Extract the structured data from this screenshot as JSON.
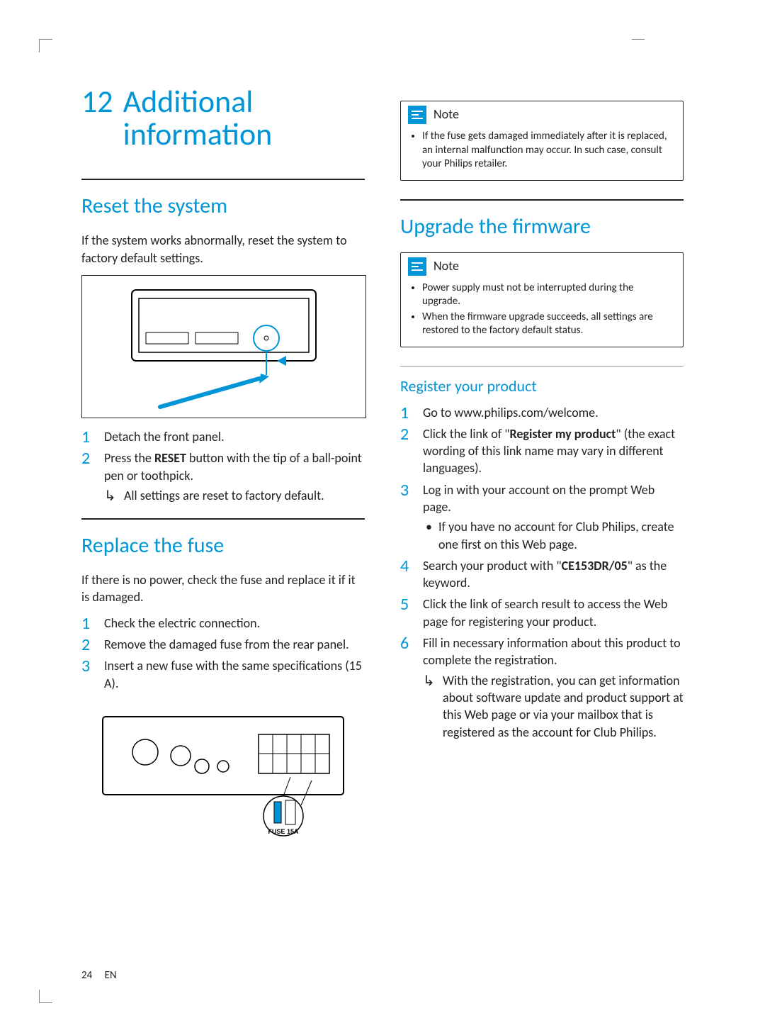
{
  "chapter": {
    "number": "12",
    "title": "Additional information"
  },
  "left": {
    "reset": {
      "heading": "Reset the system",
      "intro": "If the system works abnormally, reset the system to factory default settings.",
      "steps": [
        {
          "text": "Detach the front panel."
        },
        {
          "text_pre": "Press the ",
          "bold": "RESET",
          "text_post": " button with the tip of a ball-point pen or toothpick.",
          "result": "All settings are reset to factory default."
        }
      ]
    },
    "fuse": {
      "heading": "Replace the fuse",
      "intro": "If there is no power, check the fuse and replace it if it is damaged.",
      "steps": [
        "Check the electric connection.",
        "Remove the damaged fuse from the rear panel.",
        "Insert a new fuse with the same specifications (15 A)."
      ],
      "fuse_label": "FUSE 15A"
    }
  },
  "right": {
    "note1": {
      "label": "Note",
      "items": [
        "If the fuse gets damaged immediately after it is replaced, an internal malfunction may occur. In such case, consult your Philips retailer."
      ]
    },
    "upgrade": {
      "heading": "Upgrade the firmware"
    },
    "note2": {
      "label": "Note",
      "items": [
        "Power supply must not be interrupted during the upgrade.",
        "When the firmware upgrade succeeds, all settings are restored to the factory default status."
      ]
    },
    "register": {
      "heading": "Register your product",
      "steps": [
        {
          "text": "Go to www.philips.com/welcome."
        },
        {
          "pre": "Click the link of \"",
          "bold": "Register my product",
          "post": "\" (the exact wording of this link name may vary in different languages)."
        },
        {
          "text": "Log in with your account on the prompt Web page.",
          "sub": "If you have no account for Club Philips, create one first on this Web page."
        },
        {
          "pre": "Search your product with \"",
          "bold": "CE153DR/05",
          "post": "\" as the keyword."
        },
        {
          "text": "Click the link of search result to access the Web page for registering your product."
        },
        {
          "text": "Fill in necessary information about this product to complete the registration.",
          "result": "With the registration, you can get information about software update and product support at this Web page or via your mailbox that is registered as the account for Club Philips."
        }
      ]
    }
  },
  "footer": {
    "page": "24",
    "lang": "EN"
  }
}
